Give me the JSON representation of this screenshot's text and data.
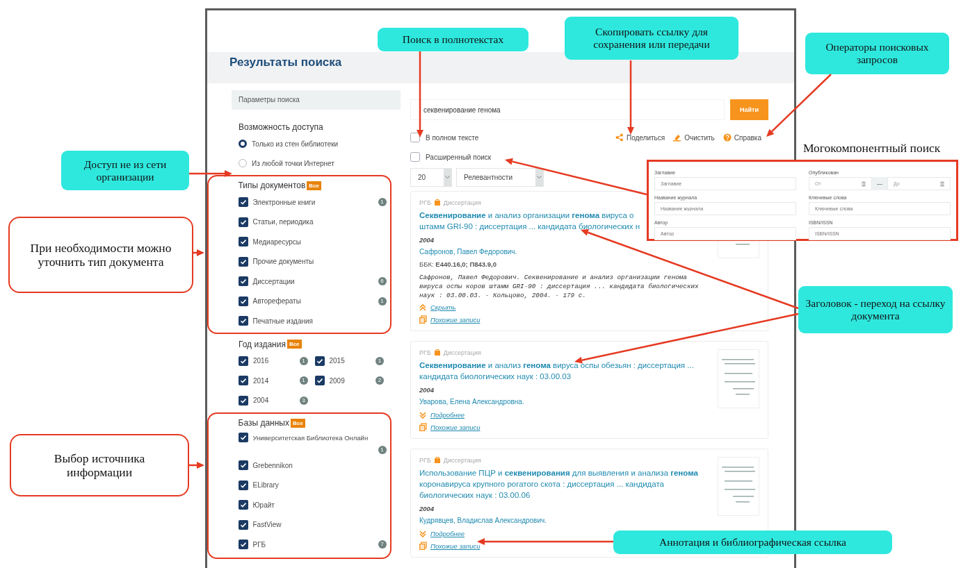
{
  "page_title": "Результаты поиска",
  "sidebar": {
    "header": "Параметры поиска",
    "access": {
      "title": "Возможность доступа",
      "options": [
        {
          "label": "Только из стен библиотеки",
          "selected": true
        },
        {
          "label": "Из любой точки Интернет",
          "selected": false
        }
      ]
    },
    "doc_types": {
      "title": "Типы документов",
      "all": "Все",
      "items": [
        {
          "label": "Электронные книги",
          "checked": true,
          "count": "1"
        },
        {
          "label": "Статьи, периодика",
          "checked": true
        },
        {
          "label": "Медиаресурсы",
          "checked": true
        },
        {
          "label": "Прочие документы",
          "checked": true
        },
        {
          "label": "Диссертации",
          "checked": true,
          "count": "6"
        },
        {
          "label": "Авторефераты",
          "checked": true,
          "count": "1"
        },
        {
          "label": "Печатные издания",
          "checked": true
        }
      ]
    },
    "years": {
      "title": "Год издания",
      "all": "Все",
      "items": [
        {
          "label": "2016",
          "checked": true,
          "count": "1"
        },
        {
          "label": "2015",
          "checked": true,
          "count": "1"
        },
        {
          "label": "2014",
          "checked": true,
          "count": "1"
        },
        {
          "label": "2009",
          "checked": true,
          "count": "2"
        },
        {
          "label": "2004",
          "checked": true,
          "count": "3"
        }
      ]
    },
    "databases": {
      "title": "Базы данных",
      "all": "Все",
      "items": [
        {
          "label": "Университетская Библиотека Онлайн",
          "checked": true,
          "count": "1"
        },
        {
          "label": "Grebennikon",
          "checked": true
        },
        {
          "label": "ELibrary",
          "checked": true
        },
        {
          "label": "Юрайт",
          "checked": true
        },
        {
          "label": "FastView",
          "checked": true
        },
        {
          "label": "РГБ",
          "checked": true,
          "count": "7"
        }
      ]
    }
  },
  "search": {
    "value": "секвенирование генома",
    "button": "Найти"
  },
  "full_text": {
    "label": "В полном тексте",
    "checked": false
  },
  "actions": [
    {
      "kind": "share",
      "label": "Поделиться"
    },
    {
      "kind": "clear",
      "label": "Очистить"
    },
    {
      "kind": "help",
      "label": "Справка"
    }
  ],
  "advanced": {
    "label": "Расширенный поиск",
    "checked": false
  },
  "page_size": "20",
  "sort": "Релевантности",
  "results": [
    {
      "source": "РГБ",
      "type": "Диссертация",
      "title_lines": [
        "**Секвенирование** и анализ организации **генома** вируса о",
        "штамм GRI-90 : диссертация ... кандидата биологических н"
      ],
      "year": "2004",
      "author": "Сафронов, Павел Федорович.",
      "bbk": "ББК: **Е440.16,0; П843.9,0**",
      "citation": "Сафронов, Павел Федорович. Секвенирование и анализ организации генома вируса оспы коров штамм GRI-90 : диссертация ... кандидата биологических наук : 03.00.03. - Кольцово, 2004. - 179 с.",
      "links": [
        {
          "kind": "hide",
          "label": "Скрыть"
        },
        {
          "kind": "similar",
          "label": "Похожие записи"
        }
      ]
    },
    {
      "source": "РГБ",
      "type": "Диссертация",
      "title": "**Секвенирование** и анализ **генома** вируса оспы обезьян : диссертация ... кандидата биологических наук : 03.00.03",
      "year": "2004",
      "author": "Уварова, Елена Александровна.",
      "links": [
        {
          "kind": "more",
          "label": "Подробнее"
        },
        {
          "kind": "similar",
          "label": "Похожие записи"
        }
      ]
    },
    {
      "source": "РГБ",
      "type": "Диссертация",
      "title": "Использование ПЦР и **секвенирования** для выявления и анализа **генома** коронавируса крупного рогатого скота : диссертация ... кандидата биологических наук : 03.00.06",
      "year": "2004",
      "author": "Кудрявцев, Владислав Александрович.",
      "links": [
        {
          "kind": "more",
          "label": "Подробнее"
        },
        {
          "kind": "similar",
          "label": "Похожие записи"
        }
      ]
    }
  ],
  "advanced_panel": {
    "title": "Могокомпонентный поиск",
    "fields": [
      {
        "kind": "text",
        "label": "Заглавие",
        "placeholder": "Заглавие"
      },
      {
        "kind": "range",
        "label": "Опубликован",
        "from": "От",
        "separator": "—",
        "to": "До"
      },
      {
        "kind": "text",
        "label": "Название журнала",
        "placeholder": "Название журнала"
      },
      {
        "kind": "text",
        "label": "Ключевые слова",
        "placeholder": "Ключевые слова"
      },
      {
        "kind": "text",
        "label": "Автор",
        "placeholder": "Автор"
      },
      {
        "kind": "text",
        "label": "ISBN/ISSN",
        "placeholder": "ISBN/ISSN"
      }
    ]
  },
  "annotations": [
    {
      "kind": "bubble",
      "text": "Поиск в полнотекстах"
    },
    {
      "kind": "bubble",
      "text": "Скопировать ссылку для сохранения или передачи"
    },
    {
      "kind": "bubble",
      "text": "Операторы поисковых запросов"
    },
    {
      "kind": "bubble",
      "text": "Доступ не из сети организации"
    },
    {
      "kind": "note",
      "text": "При необходимости можно уточнить тип документа"
    },
    {
      "kind": "bubble",
      "text": "Заголовок - переход на ссылку документа"
    },
    {
      "kind": "note",
      "text": "Выбор источника информации"
    },
    {
      "kind": "bubble",
      "text": "Аннотация и библиографическая ссылка"
    }
  ]
}
